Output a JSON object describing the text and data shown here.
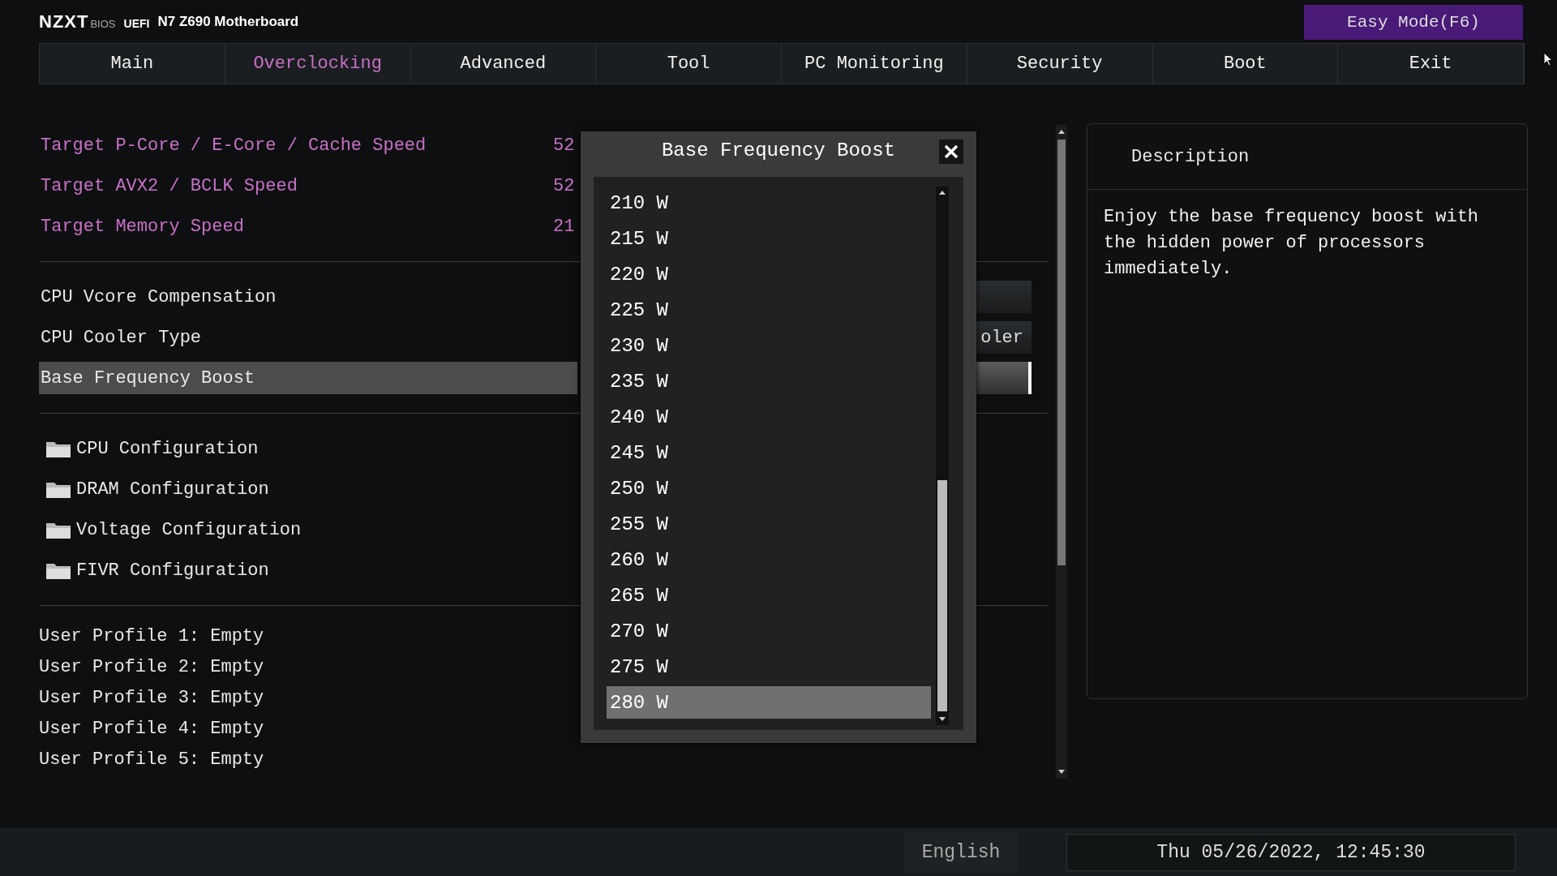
{
  "header": {
    "logo": "NZXT",
    "logo_sub": "BIOS",
    "uefi": "UEFI",
    "board": "N7 Z690 Motherboard",
    "easy_mode": "Easy Mode(F6)"
  },
  "tabs": [
    {
      "label": "Main",
      "selected": false
    },
    {
      "label": "Overclocking",
      "selected": true
    },
    {
      "label": "Advanced",
      "selected": false
    },
    {
      "label": "Tool",
      "selected": false
    },
    {
      "label": "PC Monitoring",
      "selected": false
    },
    {
      "label": "Security",
      "selected": false
    },
    {
      "label": "Boot",
      "selected": false
    },
    {
      "label": "Exit",
      "selected": false
    }
  ],
  "targets": [
    {
      "label": "Target P-Core / E-Core / Cache Speed",
      "value": "52"
    },
    {
      "label": "Target AVX2 / BCLK Speed",
      "value": "52"
    },
    {
      "label": "Target Memory Speed",
      "value": "21"
    }
  ],
  "options": [
    {
      "label": "CPU Vcore Compensation",
      "selected": false
    },
    {
      "label": "CPU Cooler Type",
      "value": "oler",
      "selected": false
    },
    {
      "label": "Base Frequency Boost",
      "selected": true
    }
  ],
  "folders": [
    {
      "label": "CPU Configuration"
    },
    {
      "label": "DRAM Configuration"
    },
    {
      "label": "Voltage Configuration"
    },
    {
      "label": "FIVR Configuration"
    }
  ],
  "profiles": [
    "User Profile 1: Empty",
    "User Profile 2: Empty",
    "User Profile 3: Empty",
    "User Profile 4: Empty",
    "User Profile 5: Empty"
  ],
  "description": {
    "title": "Description",
    "text": "Enjoy the base frequency boost with the hidden power of processors immediately."
  },
  "popup": {
    "title": "Base Frequency Boost",
    "items": [
      {
        "label": "210 W",
        "selected": false
      },
      {
        "label": "215 W",
        "selected": false
      },
      {
        "label": "220 W",
        "selected": false
      },
      {
        "label": "225 W",
        "selected": false
      },
      {
        "label": "230 W",
        "selected": false
      },
      {
        "label": "235 W",
        "selected": false
      },
      {
        "label": "240 W",
        "selected": false
      },
      {
        "label": "245 W",
        "selected": false
      },
      {
        "label": "250 W",
        "selected": false
      },
      {
        "label": "255 W",
        "selected": false
      },
      {
        "label": "260 W",
        "selected": false
      },
      {
        "label": "265 W",
        "selected": false
      },
      {
        "label": "270 W",
        "selected": false
      },
      {
        "label": "275 W",
        "selected": false
      },
      {
        "label": "280 W",
        "selected": true
      }
    ]
  },
  "status_bar": {
    "language": "English",
    "datetime": "Thu 05/26/2022, 12:45:30"
  }
}
